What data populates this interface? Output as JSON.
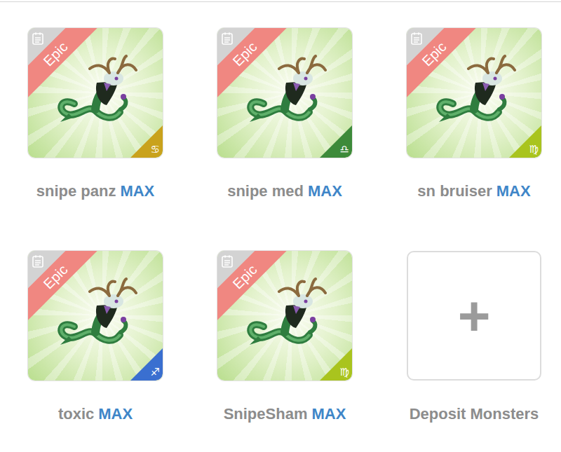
{
  "monsters": [
    {
      "name": "snipe panz",
      "max": "MAX",
      "rarity": "Epic",
      "sign": "♋",
      "color": "#c9a21c"
    },
    {
      "name": "snipe med",
      "max": "MAX",
      "rarity": "Epic",
      "sign": "♎",
      "color": "#3d8a3a"
    },
    {
      "name": "sn bruiser",
      "max": "MAX",
      "rarity": "Epic",
      "sign": "♍",
      "color": "#a9c41e"
    },
    {
      "name": "toxic",
      "max": "MAX",
      "rarity": "Epic",
      "sign": "♐",
      "color": "#3a6fd0"
    },
    {
      "name": "SnipeSham",
      "max": "MAX",
      "rarity": "Epic",
      "sign": "♍",
      "color": "#a9c41e"
    }
  ],
  "deposit": {
    "icon": "+",
    "label": "Deposit Monsters"
  }
}
